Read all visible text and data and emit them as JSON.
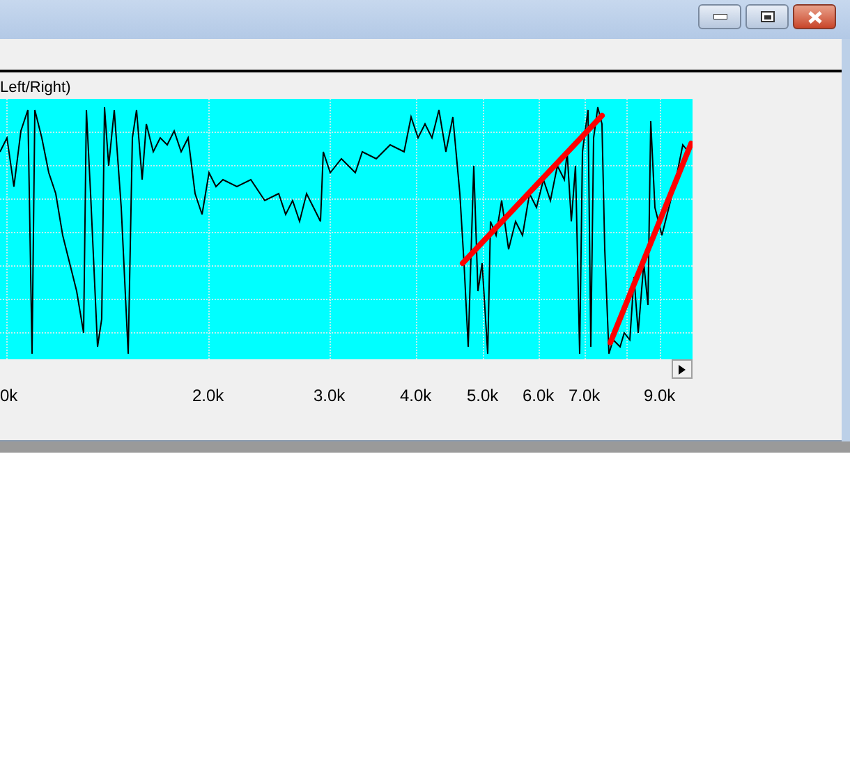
{
  "window": {
    "controls": [
      {
        "kind": "minimize"
      },
      {
        "kind": "maximize"
      },
      {
        "kind": "close"
      }
    ]
  },
  "chart": {
    "title": "Left/Right)",
    "x_tick_labels": [
      "0k",
      "2.0k",
      "3.0k",
      "4.0k",
      "5.0k",
      "6.0k",
      "7.0k",
      "9.0k"
    ]
  }
}
